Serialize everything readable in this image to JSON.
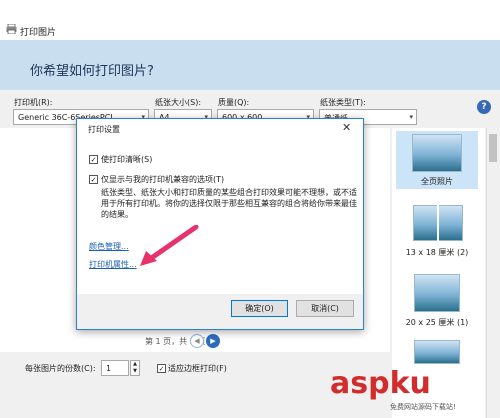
{
  "window": {
    "title": "打印图片"
  },
  "header": {
    "question": "你希望如何打印图片?"
  },
  "settings": {
    "printer_label": "打印机(R):",
    "printer_value": "Generic 36C-6SeriesPCL",
    "paper_size_label": "纸张大小(S):",
    "paper_size_value": "A4",
    "quality_label": "质量(Q):",
    "quality_value": "600 x 600",
    "paper_type_label": "纸张类型(T):",
    "paper_type_value": "普通纸"
  },
  "preview": {
    "pages_text": "第 1 页，共 2 页"
  },
  "layouts": [
    {
      "label": "全页照片",
      "selected": true
    },
    {
      "label": "13 x 18 厘米 (2)",
      "selected": false
    },
    {
      "label": "20 x 25 厘米 (1)",
      "selected": false
    }
  ],
  "bottom": {
    "copies_label": "每张图片的份数(C):",
    "copies_value": "1",
    "fit_label": "适应边框打印(F)",
    "fit_checked": true
  },
  "dialog": {
    "title": "打印设置",
    "sharpen_label": "使打印清晰(S)",
    "compatible_label": "仅显示与我的打印机兼容的选项(T)",
    "description": "纸张类型、纸张大小和打印质量的某些组合打印效果可能不理想，或不适用于所有打印机。将你的选择仅限于那些相互兼容的组合将给你带来最佳的结果。",
    "color_mgmt_link": "颜色管理...",
    "printer_props_link": "打印机属性...",
    "ok_label": "确定(O)",
    "cancel_label": "取消(C)"
  },
  "watermark": {
    "brand": "aspku",
    "sub": "免费网站源码下载站!"
  }
}
